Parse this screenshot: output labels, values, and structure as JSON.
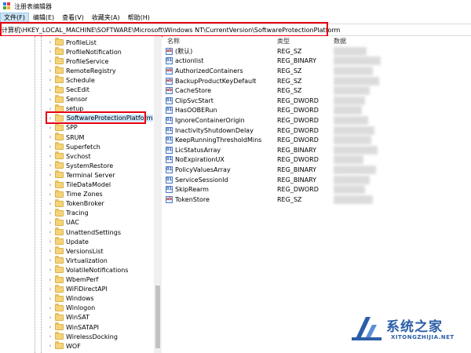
{
  "window": {
    "title": "注册表编辑器"
  },
  "menu": [
    {
      "label": "文件(F)"
    },
    {
      "label": "编辑(E)"
    },
    {
      "label": "查看(V)"
    },
    {
      "label": "收藏夹(A)"
    },
    {
      "label": "帮助(H)"
    }
  ],
  "address": {
    "path": "计算机\\HKEY_LOCAL_MACHINE\\SOFTWARE\\Microsoft\\Windows NT\\CurrentVersion\\SoftwareProtectionPlatform"
  },
  "tree": {
    "items": [
      {
        "label": "ProfileList"
      },
      {
        "label": "ProfileNotification"
      },
      {
        "label": "ProfileService"
      },
      {
        "label": "RemoteRegistry"
      },
      {
        "label": "Schedule"
      },
      {
        "label": "SecEdit"
      },
      {
        "label": "Sensor"
      },
      {
        "label": "setup"
      },
      {
        "label": "SoftwareProtectionPlatform",
        "selected": true
      },
      {
        "label": "SPP"
      },
      {
        "label": "SRUM"
      },
      {
        "label": "Superfetch"
      },
      {
        "label": "Svchost"
      },
      {
        "label": "SystemRestore"
      },
      {
        "label": "Terminal Server"
      },
      {
        "label": "TileDataModel"
      },
      {
        "label": "Time Zones"
      },
      {
        "label": "TokenBroker"
      },
      {
        "label": "Tracing"
      },
      {
        "label": "UAC"
      },
      {
        "label": "UnattendSettings"
      },
      {
        "label": "Update"
      },
      {
        "label": "VersionsList"
      },
      {
        "label": "Virtualization"
      },
      {
        "label": "VolatileNotifications"
      },
      {
        "label": "WbemPerf"
      },
      {
        "label": "WiFiDirectAPI"
      },
      {
        "label": "Windows"
      },
      {
        "label": "Winlogon"
      },
      {
        "label": "WinSAT"
      },
      {
        "label": "WinSATAPI"
      },
      {
        "label": "WirelessDocking"
      },
      {
        "label": "WOF"
      }
    ]
  },
  "columns": {
    "name": "名称",
    "type": "类型",
    "data": "数据"
  },
  "values": [
    {
      "name": "(默认)",
      "type": "REG_SZ",
      "icon": "ab"
    },
    {
      "name": "actionlist",
      "type": "REG_BINARY",
      "icon": "bin"
    },
    {
      "name": "AuthorizedContainers",
      "type": "REG_SZ",
      "icon": "ab"
    },
    {
      "name": "BackupProductKeyDefault",
      "type": "REG_SZ",
      "icon": "ab"
    },
    {
      "name": "CacheStore",
      "type": "REG_SZ",
      "icon": "ab"
    },
    {
      "name": "ClipSvcStart",
      "type": "REG_DWORD",
      "icon": "bin"
    },
    {
      "name": "HasOOBERun",
      "type": "REG_DWORD",
      "icon": "bin"
    },
    {
      "name": "IgnoreContainerOrigin",
      "type": "REG_DWORD",
      "icon": "bin"
    },
    {
      "name": "InactivityShutdownDelay",
      "type": "REG_DWORD",
      "icon": "bin"
    },
    {
      "name": "KeepRunningThresholdMins",
      "type": "REG_DWORD",
      "icon": "bin"
    },
    {
      "name": "LicStatusArray",
      "type": "REG_BINARY",
      "icon": "bin"
    },
    {
      "name": "NoExpirationUX",
      "type": "REG_DWORD",
      "icon": "bin"
    },
    {
      "name": "PolicyValuesArray",
      "type": "REG_BINARY",
      "icon": "bin"
    },
    {
      "name": "ServiceSessionId",
      "type": "REG_BINARY",
      "icon": "bin"
    },
    {
      "name": "SkipRearm",
      "type": "REG_DWORD",
      "icon": "bin"
    },
    {
      "name": "TokenStore",
      "type": "REG_SZ",
      "icon": "ab"
    }
  ],
  "watermark": {
    "brand": "系统之家",
    "url": "XITONGZHIJIA.NET"
  },
  "colors": {
    "highlight": "#e60012",
    "selection": "#cce8ff",
    "folder": "#f5d37a",
    "watermark": "#2b5ea8"
  }
}
